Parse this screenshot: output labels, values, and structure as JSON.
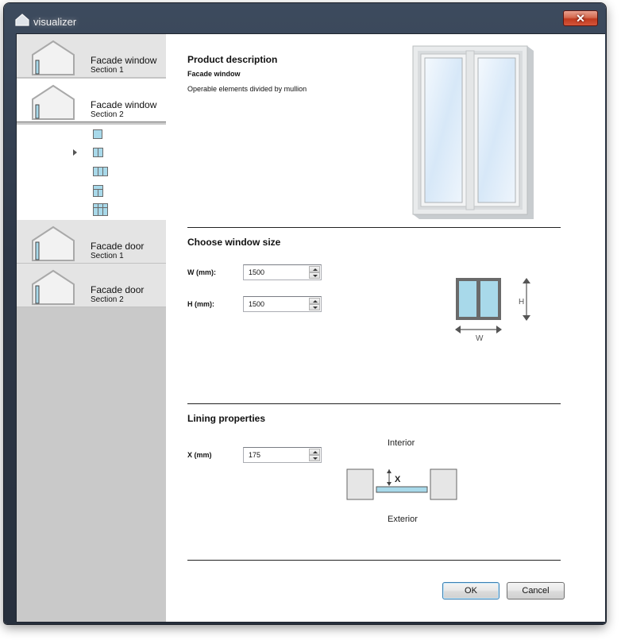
{
  "window": {
    "title": "visualizer",
    "close_glyph": "✕"
  },
  "sidebar": {
    "items": [
      {
        "title": "Facade window",
        "subtitle": "Section 1",
        "icon": "house-window-icon"
      },
      {
        "title": "Facade window",
        "subtitle": "Section 2",
        "icon": "house-window-icon"
      },
      {
        "title": "Facade door",
        "subtitle": "Section 1",
        "icon": "house-door-icon"
      },
      {
        "title": "Facade door",
        "subtitle": "Section 2",
        "icon": "house-door-icon"
      }
    ],
    "variants": [
      "single-pane-icon",
      "two-pane-icon",
      "three-pane-icon",
      "transom-two-pane-icon",
      "grid-pane-icon"
    ],
    "selected_variant": 1
  },
  "product": {
    "heading": "Product description",
    "name": "Facade window",
    "description": "Operable elements divided by mullion"
  },
  "size": {
    "heading": "Choose window size",
    "w_label": "W (mm):",
    "w_value": "1500",
    "h_label": "H (mm):",
    "h_value": "1500",
    "diagram_w": "W",
    "diagram_h": "H"
  },
  "lining": {
    "heading": "Lining properties",
    "x_label": "X (mm)",
    "x_value": "175",
    "interior": "Interior",
    "exterior": "Exterior",
    "diagram_x": "X"
  },
  "buttons": {
    "ok": "OK",
    "cancel": "Cancel"
  },
  "colors": {
    "glass": "#a8d9ea",
    "frame": "#6a6a6a",
    "sidebar_bg": "#c9c9c9",
    "accent": "#3c7fb1"
  }
}
